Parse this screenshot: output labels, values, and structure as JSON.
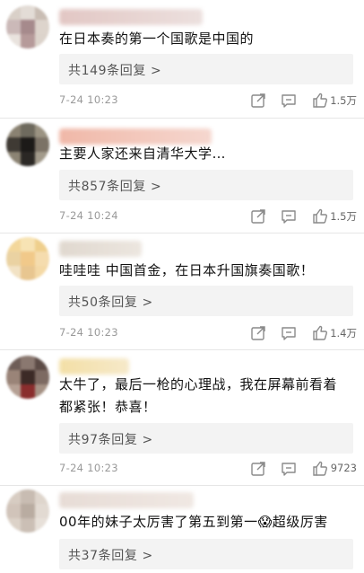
{
  "comments": [
    {
      "text": "在日本奏的第一个国歌是中国的",
      "replies": "共149条回复 >",
      "time": "7-24  10:23",
      "likes": "1.5万",
      "avatar_colors": [
        "#d9d0c8",
        "#e3dcd6",
        "#c9bdb4",
        "#cbb9b8",
        "#a68a8c",
        "#ddd4cc",
        "#e9e3de",
        "#b69a9a",
        "#dcd3cb"
      ],
      "name_colors": [
        "#e2c7c4",
        "#ece0de"
      ]
    },
    {
      "text": "主要人家还来自清华大学…",
      "replies": "共857条回复 >",
      "time": "7-24  10:24",
      "likes": "1.5万",
      "avatar_colors": [
        "#8a8272",
        "#6e6a5e",
        "#9b9382",
        "#3f3a34",
        "#1c1a18",
        "#7b7266",
        "#8c8474",
        "#2b2825",
        "#a29a8b"
      ],
      "name_colors": [
        "#f0b8a8",
        "#f5d7cf"
      ]
    },
    {
      "text": "哇哇哇 中国首金，在日本升国旗奏国歌！",
      "replies": "共50条回复 >",
      "time": "7-24  10:23",
      "likes": "1.4万",
      "avatar_colors": [
        "#f3d79b",
        "#f7e3b4",
        "#efcf8d",
        "#ead2a2",
        "#f1c98a",
        "#f5dcae",
        "#f2e2c4",
        "#e8c690",
        "#f4d9a6"
      ],
      "name_colors": [
        "#e0d8cf",
        "#ece6df"
      ]
    },
    {
      "text": "太牛了，最后一枪的心理战，我在屏幕前看着都紧张！恭喜！",
      "replies": "共97条回复 >",
      "time": "7-24  10:23",
      "likes": "9723",
      "avatar_colors": [
        "#6e5d57",
        "#8a7870",
        "#5c4b46",
        "#9a8478",
        "#3c2a26",
        "#7d6a62",
        "#b5a094",
        "#8a2d2d",
        "#a59184"
      ],
      "name_colors": [
        "#f3dfa6",
        "#f6e9c9"
      ]
    },
    {
      "text": "00年的妹子太厉害了第五到第一😱超级厉害",
      "replies": "共37条回复 >",
      "avatar_colors": [
        "#d7ccc2",
        "#c8bcb2",
        "#ded5cc",
        "#d1c4ba",
        "#b9aca1",
        "#e2dad2",
        "#dcd2c8",
        "#cbbfb5",
        "#e7e0d9"
      ],
      "name_colors": [
        "#e7dcd6",
        "#f0e8e3"
      ]
    }
  ]
}
